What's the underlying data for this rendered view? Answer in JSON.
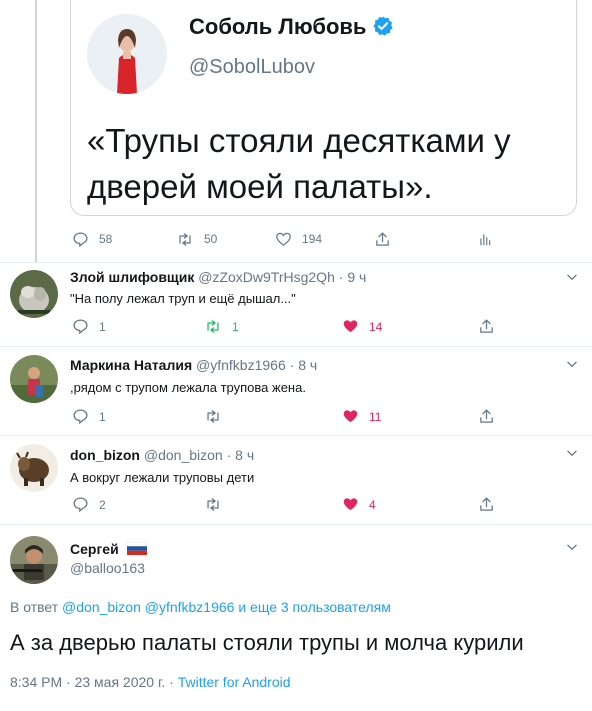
{
  "quoted_tweet": {
    "name": "Соболь Любовь",
    "handle": "@SobolLubov",
    "text": "«Трупы стояли десятками у дверей моей палаты».",
    "stats": {
      "replies": "58",
      "retweets": "50",
      "likes": "194"
    }
  },
  "replies": [
    {
      "name": "Злой шлифовщик",
      "handle": "@zZoxDw9TrHsg2Qh",
      "dot": "·",
      "time": "9 ч",
      "text": "\"На полу лежал труп и ещё дышал...\"",
      "reply_count": "1",
      "retweet_count": "1",
      "like_count": "14",
      "retweeted": true
    },
    {
      "name": "Маркина Наталия",
      "handle": "@yfnfkbz1966",
      "dot": "·",
      "time": "8 ч",
      "text": ",рядом с трупом лежала трупова жена.",
      "reply_count": "1",
      "retweet_count": "",
      "like_count": "11",
      "retweeted": false
    },
    {
      "name": "don_bizon",
      "handle": "@don_bizon",
      "dot": "·",
      "time": "8 ч",
      "text": "А вокруг лежали труповы дети",
      "reply_count": "2",
      "retweet_count": "",
      "like_count": "4",
      "retweeted": false
    }
  ],
  "main_tweet": {
    "name": "Сергей",
    "handle": "@balloo163",
    "reply_to_prefix": "В ответ",
    "reply_to_links": "@don_bizon @yfnfkbz1966 и еще 3 пользователям",
    "text": "А за дверью палаты стояли трупы и молча курили",
    "timestamp": "8:34 PM · 23 мая 2020 г. ·",
    "source": "Twitter for Android"
  },
  "colors": {
    "accent": "#1da1f2",
    "like": "#e0245e",
    "retweet": "#17bf63",
    "muted": "#657786"
  }
}
